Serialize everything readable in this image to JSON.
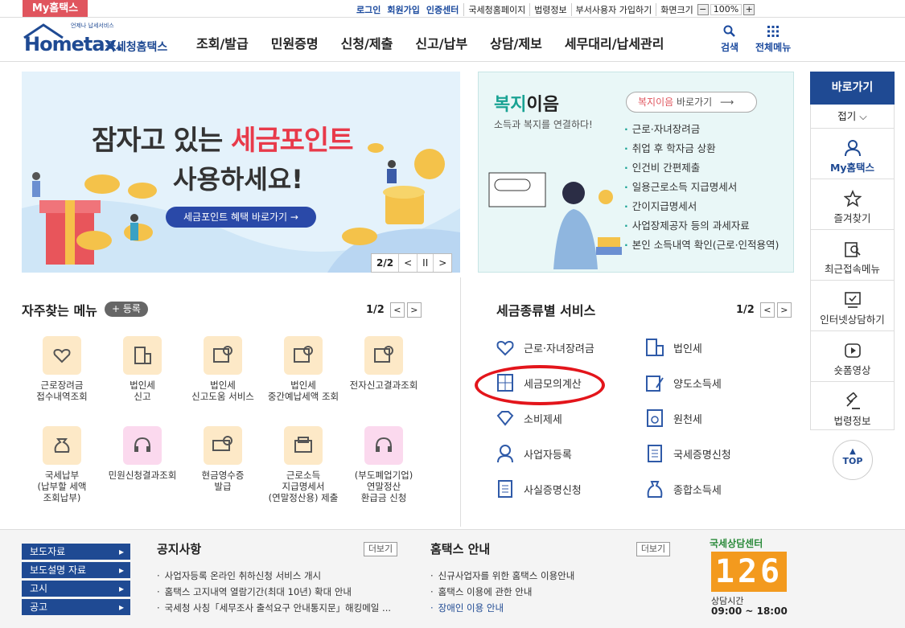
{
  "topbar": {
    "my_home": "My홈택스",
    "links_blue": [
      "로그인",
      "회원가입",
      "인증센터"
    ],
    "links": [
      "국세청홈페이지",
      "법령정보",
      "부서사용자 가입하기",
      "화면크기"
    ],
    "zoom_minus": "−",
    "zoom_value": "100%",
    "zoom_plus": "+"
  },
  "header": {
    "logo_small": "언제나 납세서비스",
    "logo_main": "Hometax.",
    "logo_sub": "국세청홈택스",
    "nav": [
      "조회/발급",
      "민원증명",
      "신청/제출",
      "신고/납부",
      "상담/제보",
      "세무대리/납세관리"
    ],
    "search_label": "검색",
    "allmenu_label": "전체메뉴"
  },
  "banner": {
    "line1_pre": "잠자고 있는 ",
    "line1_highlight": "세금포인트",
    "line2": "사용하세요!",
    "button": "세금포인트 혜택 바로가기 →",
    "page": "2/2",
    "prev": "<",
    "pause": "II",
    "next": ">"
  },
  "welfare": {
    "title_a": "복지",
    "title_b": "이음",
    "subtitle": "소득과 복지를 연결하다!",
    "link_a": "복지이음",
    "link_b": " 바로가기",
    "items": [
      "근로·자녀장려금",
      "취업 후 학자금 상환",
      "인건비 간편제출",
      "일용근로소득 지급명세서",
      "간이지급명세서",
      "사업장제공자 등의 과세자료",
      "본인 소득내역 확인(근로·인적용역)"
    ]
  },
  "favorites": {
    "title": "자주찾는 메뉴",
    "register": "+ 등록",
    "page": "1/2",
    "items": [
      {
        "line1": "근로장려금",
        "line2": "접수내역조회",
        "line3": ""
      },
      {
        "line1": "법인세",
        "line2": "신고",
        "line3": ""
      },
      {
        "line1": "법인세",
        "line2": "신고도움 서비스",
        "line3": ""
      },
      {
        "line1": "법인세",
        "line2": "중간예납세액 조회",
        "line3": ""
      },
      {
        "line1": "전자신고결과조회",
        "line2": "",
        "line3": ""
      },
      {
        "line1": "국세납부",
        "line2": "(납부할 세액",
        "line3": "조회납부)"
      },
      {
        "line1": "민원신청결과조회",
        "line2": "",
        "line3": ""
      },
      {
        "line1": "현금영수증",
        "line2": "발급",
        "line3": ""
      },
      {
        "line1": "근로소득",
        "line2": "지급명세서",
        "line3": "(연말정산용) 제출"
      },
      {
        "line1": "(부도폐업기업)",
        "line2": "연말정산",
        "line3": "환급금 신청"
      }
    ]
  },
  "services": {
    "title": "세금종류별 서비스",
    "page": "1/2",
    "left": [
      "근로·자녀장려금",
      "세금모의계산",
      "소비제세",
      "사업자등록",
      "사실증명신청"
    ],
    "right": [
      "법인세",
      "양도소득세",
      "원천세",
      "국세증명신청",
      "종합소득세"
    ]
  },
  "sidebar": {
    "title": "바로가기",
    "fold": "접기 ⌵",
    "items": [
      "My홈택스",
      "즐겨찾기",
      "최근접속메뉴",
      "인터넷상담하기",
      "숏폼영상",
      "법령정보"
    ],
    "top": "TOP"
  },
  "footer": {
    "menus": [
      "보도자료",
      "보도설명 자료",
      "고시",
      "공고"
    ],
    "notice_title": "공지사항",
    "notice_more": "더보기",
    "notices": [
      "사업자등록 온라인 취하신청 서비스 개시",
      "홈택스 고지내역 열람기간(최대 10년) 확대 안내",
      "국세청 사칭「세무조사 출석요구 안내통지문」해킹메일 ..."
    ],
    "guide_title": "홈택스 안내",
    "guide_more": "더보기",
    "guides": [
      "신규사업자를 위한 홈택스 이용안내",
      "홈택스 이용에 관한 안내",
      "장애인 이용 안내"
    ],
    "cc_title": "국세상담센터",
    "cc_number": "126",
    "cc_label": "상담시간",
    "cc_hours": "09:00 ~ 18:00"
  },
  "colors": {
    "brand_blue": "#1f4a93",
    "accent_red": "#e83a4a",
    "welfare_green": "#1aa394"
  }
}
